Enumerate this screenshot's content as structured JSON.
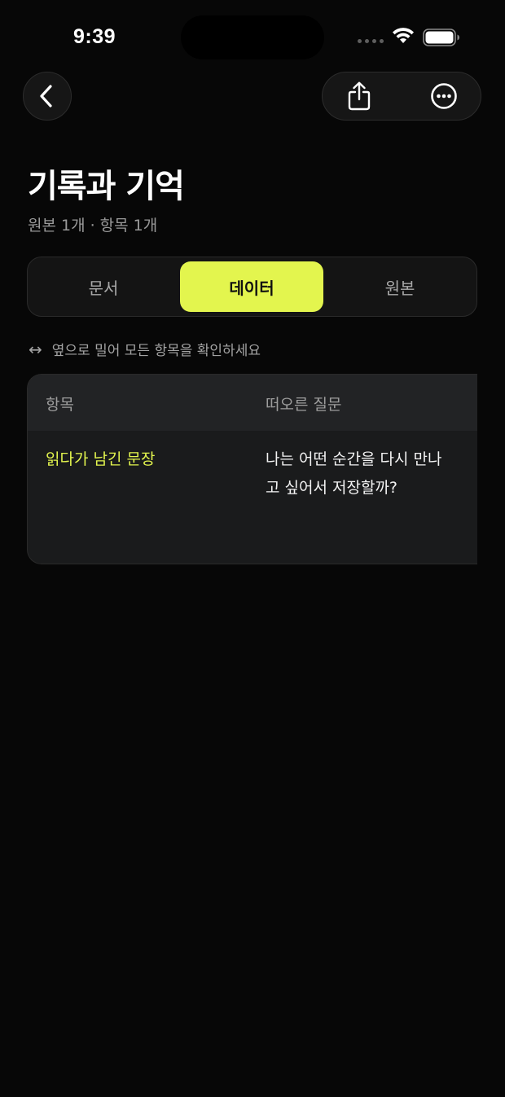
{
  "status_bar": {
    "time": "9:39"
  },
  "header": {
    "back_icon": "chevron-left-icon",
    "share_icon": "share-icon",
    "more_icon": "ellipsis-circle-icon"
  },
  "page": {
    "title": "기록과 기억",
    "subtitle": "원본 1개 · 항목 1개"
  },
  "tabs": [
    {
      "label": "문서",
      "selected": false
    },
    {
      "label": "데이터",
      "selected": true
    },
    {
      "label": "원본",
      "selected": false
    }
  ],
  "hint": {
    "icon": "↔",
    "text": "옆으로 밀어 모든 항목을 확인하세요"
  },
  "table": {
    "columns": [
      "항목",
      "떠오른 질문"
    ],
    "rows": [
      {
        "item": "읽다가 남긴 문장",
        "question": "나는 어떤 순간을 다시 만나고 싶어서 저장할까?"
      }
    ]
  },
  "colors": {
    "accent": "#e3f54e",
    "background": "#070707",
    "surface": "#141414"
  }
}
